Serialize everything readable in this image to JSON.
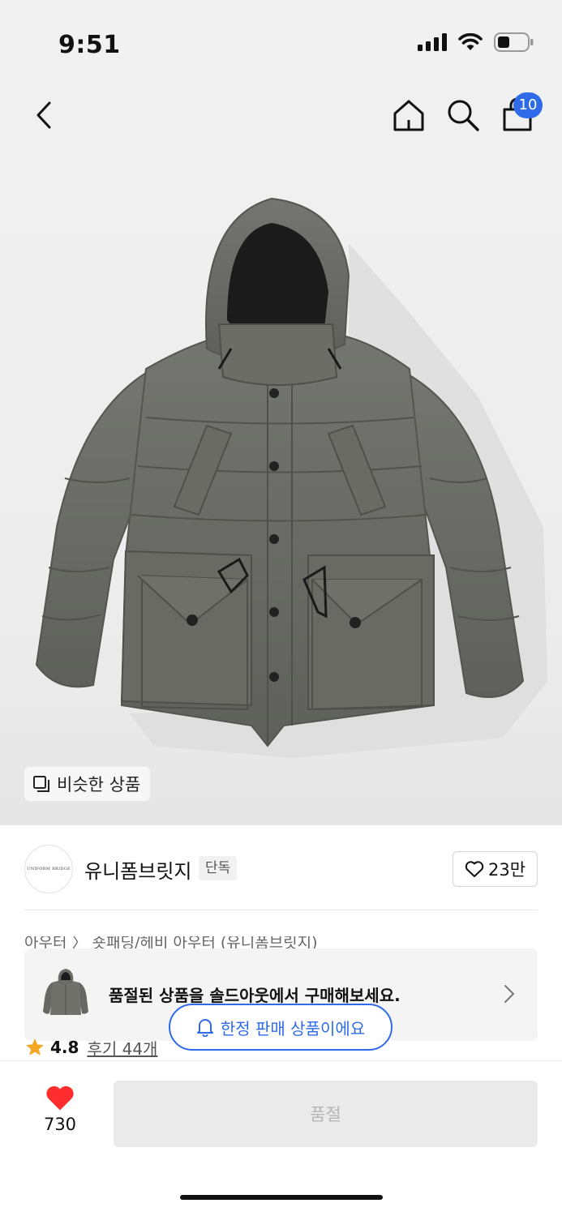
{
  "status_bar": {
    "time": "9:51",
    "icons": [
      "cellular-signal-icon",
      "wifi-icon",
      "battery-icon"
    ]
  },
  "nav": {
    "icons": [
      "back-chevron-icon",
      "home-icon",
      "search-icon",
      "shopping-bag-icon"
    ],
    "cart_badge": "10"
  },
  "product": {
    "image_desc_icon": "hooded-puffer-jacket-image",
    "similar_products_label": "비슷한 상품"
  },
  "brand": {
    "logo_text": "UNIFORM BRIDGE",
    "name": "유니폼브릿지",
    "tag": "단독",
    "like_count": "23만"
  },
  "breadcrumb": {
    "text": "아우터  〉 숏패딩/헤비 아우터  (유니폼브릿지)"
  },
  "soldout_banner": {
    "message": "품절된 상품을 솔드아웃에서 구매해보세요."
  },
  "limited_pill": {
    "label": "한정 판매 상품이에요"
  },
  "rating": {
    "score": "4.8",
    "reviews": "후기 44개"
  },
  "bottom_bar": {
    "like_count": "730",
    "purchase_label": "품절"
  },
  "colors": {
    "accent_blue": "#2f6be8",
    "heart_red": "#ff2d2d",
    "star_orange": "#f5a623",
    "jacket_gray": "#6b6c66"
  }
}
